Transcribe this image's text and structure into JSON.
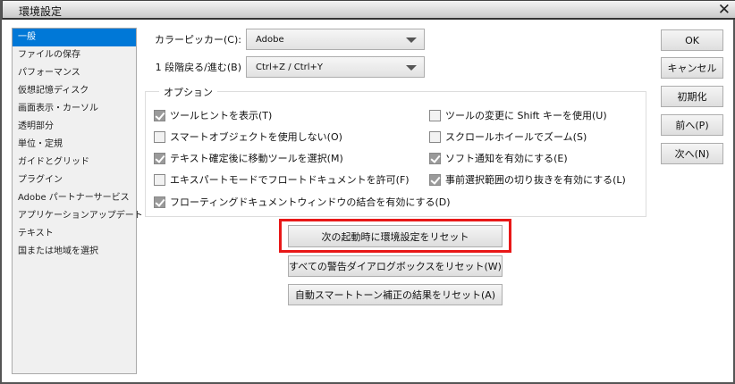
{
  "window": {
    "title": "環境設定"
  },
  "sidebar": {
    "items": [
      {
        "label": "一般",
        "selected": true
      },
      {
        "label": "ファイルの保存"
      },
      {
        "label": "パフォーマンス"
      },
      {
        "label": "仮想記憶ディスク"
      },
      {
        "label": "画面表示・カーソル"
      },
      {
        "label": "透明部分"
      },
      {
        "label": "単位・定規"
      },
      {
        "label": "ガイドとグリッド"
      },
      {
        "label": "プラグイン"
      },
      {
        "label": "Adobe パートナーサービス"
      },
      {
        "label": "アプリケーションアップデート"
      },
      {
        "label": "テキスト"
      },
      {
        "label": "国または地域を選択"
      }
    ]
  },
  "fields": {
    "color_picker_label": "カラーピッカー(C):",
    "color_picker_value": "Adobe",
    "undo_label": "1 段階戻る/進む(B)",
    "undo_value": "Ctrl+Z / Ctrl+Y"
  },
  "options": {
    "legend": "オプション",
    "checkboxes": [
      {
        "label": "ツールヒントを表示(T)",
        "checked": true
      },
      {
        "label": "スマートオブジェクトを使用しない(O)",
        "checked": false
      },
      {
        "label": "テキスト確定後に移動ツールを選択(M)",
        "checked": true
      },
      {
        "label": "エキスパートモードでフロートドキュメントを許可(F)",
        "checked": false
      },
      {
        "label": "フローティングドキュメントウィンドウの結合を有効にする(D)",
        "checked": true
      },
      {
        "label": "ツールの変更に Shift キーを使用(U)",
        "checked": false
      },
      {
        "label": "スクロールホイールでズーム(S)",
        "checked": false
      },
      {
        "label": "ソフト通知を有効にする(E)",
        "checked": true
      },
      {
        "label": "事前選択範囲の切り抜きを有効にする(L)",
        "checked": true
      }
    ]
  },
  "reset_buttons": {
    "prefs": "次の起動時に環境設定をリセット",
    "warnings": "すべての警告ダイアログボックスをリセット(W)",
    "smart_tone": "自動スマートトーン補正の結果をリセット(A)"
  },
  "actions": {
    "ok": "OK",
    "cancel": "キャンセル",
    "reset": "初期化",
    "prev": "前へ(P)",
    "next": "次へ(N)"
  },
  "colors": {
    "selection": "#0078d7",
    "highlight": "#e81818"
  }
}
